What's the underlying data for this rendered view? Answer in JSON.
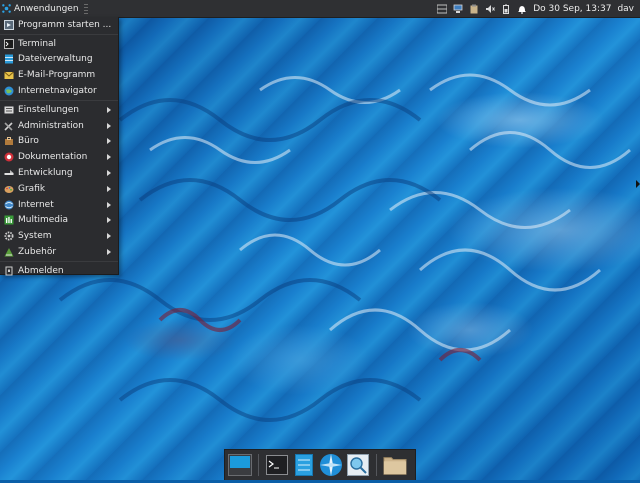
{
  "top_panel": {
    "apps_label": "Anwendungen",
    "clock": "Do 30 Sep, 13:37",
    "user": "dav",
    "tray_icons": [
      "workspace-icon",
      "network-icon",
      "clipboard-icon",
      "volume-icon",
      "battery-icon",
      "notification-bell-icon"
    ]
  },
  "menu": {
    "items": [
      {
        "label": "Programm starten ...",
        "icon": "run-icon",
        "submenu": false
      },
      {
        "label": "Terminal",
        "icon": "terminal-icon",
        "submenu": false
      },
      {
        "label": "Dateiverwaltung",
        "icon": "file-manager-icon",
        "submenu": false
      },
      {
        "label": "E-Mail-Programm",
        "icon": "mail-icon",
        "submenu": false
      },
      {
        "label": "Internetnavigator",
        "icon": "browser-icon",
        "submenu": false
      },
      {
        "label": "Einstellungen",
        "icon": "settings-icon",
        "submenu": true
      },
      {
        "label": "Administration",
        "icon": "admin-tools-icon",
        "submenu": true
      },
      {
        "label": "Büro",
        "icon": "office-icon",
        "submenu": true
      },
      {
        "label": "Dokumentation",
        "icon": "help-icon",
        "submenu": true
      },
      {
        "label": "Entwicklung",
        "icon": "development-icon",
        "submenu": true
      },
      {
        "label": "Grafik",
        "icon": "graphics-icon",
        "submenu": true
      },
      {
        "label": "Internet",
        "icon": "internet-icon",
        "submenu": true
      },
      {
        "label": "Multimedia",
        "icon": "multimedia-icon",
        "submenu": true
      },
      {
        "label": "System",
        "icon": "system-icon",
        "submenu": true
      },
      {
        "label": "Zubehör",
        "icon": "accessories-icon",
        "submenu": true
      },
      {
        "label": "Abmelden",
        "icon": "logout-icon",
        "submenu": false
      }
    ]
  },
  "dock": {
    "items": [
      "show-desktop-icon",
      "terminal-icon",
      "text-editor-icon",
      "web-browser-icon",
      "search-icon",
      "files-folder-icon"
    ]
  },
  "colors": {
    "panel_bg": "#2f3033",
    "menu_bg": "#2b2c2f",
    "accent": "#1b9bdc"
  }
}
